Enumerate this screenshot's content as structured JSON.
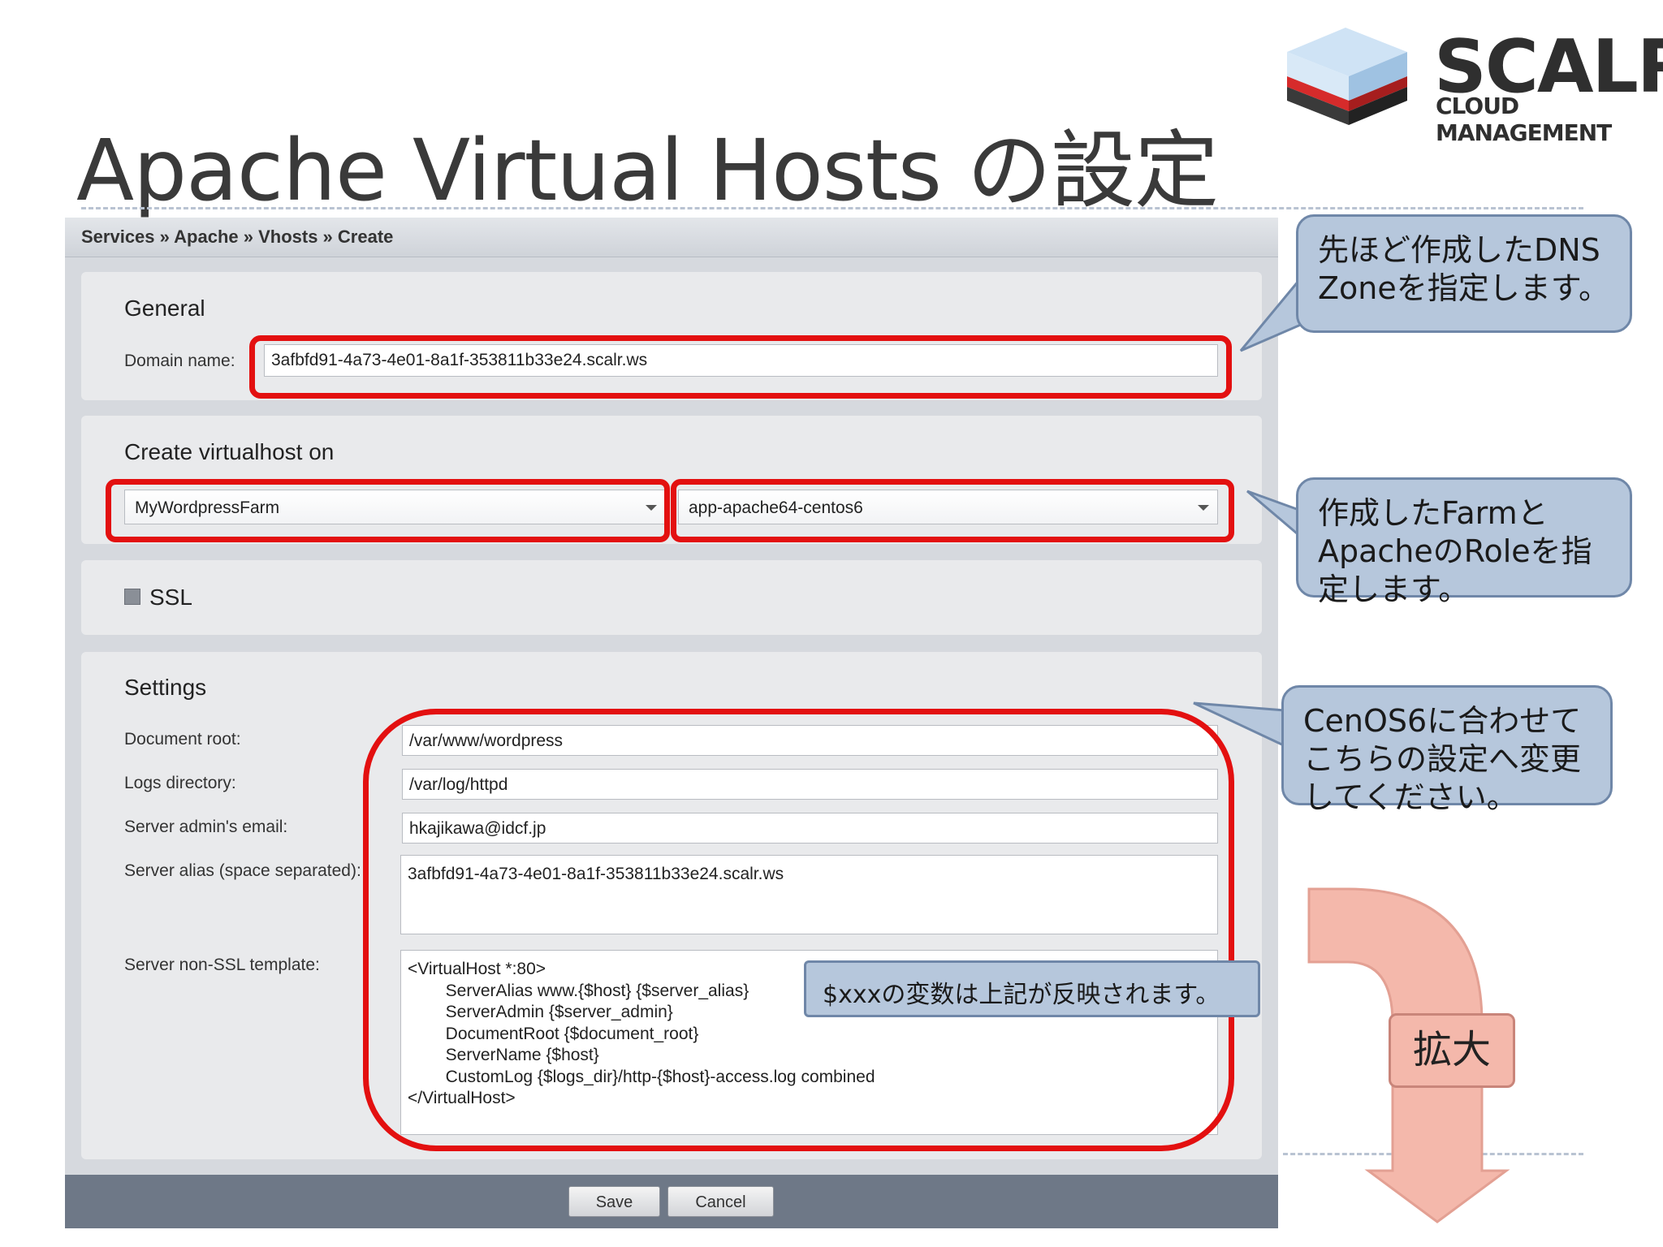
{
  "slide": {
    "title": "Apache Virtual Hosts の設定",
    "logo_word": "SCALR",
    "logo_sub": "CLOUD MANAGEMENT"
  },
  "app": {
    "breadcrumb": "Services » Apache » Vhosts » Create",
    "general": {
      "legend": "General",
      "domain_label": "Domain name:",
      "domain_value": "3afbfd91-4a73-4e01-8a1f-353811b33e24.scalr.ws"
    },
    "create_on": {
      "legend": "Create virtualhost on",
      "farm_value": "MyWordpressFarm",
      "role_value": "app-apache64-centos6"
    },
    "ssl": {
      "label": "SSL",
      "checked": false
    },
    "settings": {
      "legend": "Settings",
      "docroot_label": "Document root:",
      "docroot_value": "/var/www/wordpress",
      "logs_label": "Logs directory:",
      "logs_value": "/var/log/httpd",
      "email_label": "Server admin's email:",
      "email_value": "hkajikawa@idcf.jp",
      "alias_label": "Server alias (space separated):",
      "alias_value": "3afbfd91-4a73-4e01-8a1f-353811b33e24.scalr.ws",
      "template_label": "Server non-SSL template:",
      "template_value": "<VirtualHost *:80>\n        ServerAlias www.{$host} {$server_alias}\n        ServerAdmin {$server_admin}\n        DocumentRoot {$document_root}\n        ServerName {$host}\n        CustomLog {$logs_dir}/http-{$host}-access.log combined\n</VirtualHost>"
    },
    "buttons": {
      "save": "Save",
      "cancel": "Cancel"
    }
  },
  "callouts": {
    "dns": "先ほど作成したDNS Zoneを指定します。",
    "farm_role": "作成したFarmとApacheのRoleを指定します。",
    "centos": "CenOS6に合わせてこちらの設定へ変更してください。",
    "variables": "$xxxの変数は上記が反映されます。",
    "enlarge": "拡大"
  },
  "colors": {
    "highlight": "#e31010",
    "callout_fill": "#b6c7dc",
    "arrow_fill": "#f4b8ab",
    "footer": "#6e7887"
  }
}
